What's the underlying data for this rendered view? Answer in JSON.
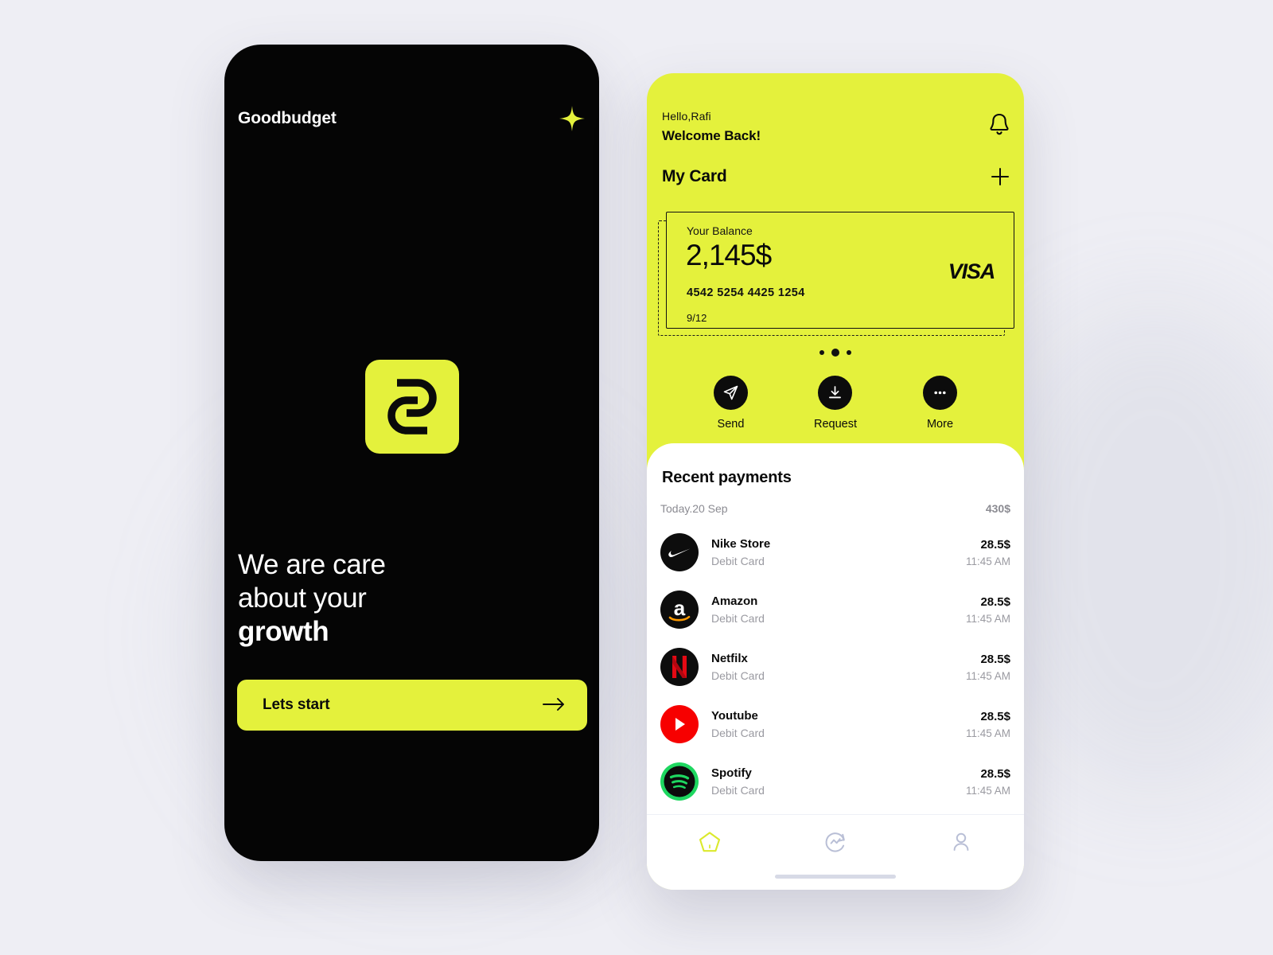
{
  "theme": {
    "accent": "#E4F13C",
    "black": "#050505",
    "page_background": "#EEEEF4",
    "sheet_background": "#FFFFFF",
    "muted_text": "#9A9AA1"
  },
  "onboarding": {
    "brand": "Goodbudget",
    "sparkle_icon": "sparkle-icon",
    "logo_icon": "goodbudget-logo-icon",
    "headline_lines": [
      "We are care",
      "about your",
      "growth"
    ],
    "cta_label": "Lets start",
    "cta_icon": "arrow-right-icon"
  },
  "dashboard": {
    "greeting_small": "Hello,Rafi",
    "greeting_large": "Welcome Back!",
    "bell_icon": "bell-icon",
    "section_title": "My Card",
    "add_icon": "plus-icon",
    "card": {
      "balance_label": "Your Balance",
      "balance_value": "2,145$",
      "number": "4542  5254  4425  1254",
      "expiry": "9/12",
      "network": "VISA"
    },
    "pagination": {
      "count": 3,
      "active_index": 1
    },
    "actions": [
      {
        "label": "Send",
        "icon": "send-plane-icon"
      },
      {
        "label": "Request",
        "icon": "download-tray-icon"
      },
      {
        "label": "More",
        "icon": "ellipsis-icon"
      }
    ],
    "payments": {
      "title": "Recent payments",
      "day_label": "Today.20 Sep",
      "day_total": "430$",
      "rows": [
        {
          "name": "Nike Store",
          "method": "Debit Card",
          "amount": "28.5$",
          "time": "11:45 AM",
          "icon": "nike-logo-icon"
        },
        {
          "name": "Amazon",
          "method": "Debit Card",
          "amount": "28.5$",
          "time": "11:45 AM",
          "icon": "amazon-logo-icon"
        },
        {
          "name": "Netfilx",
          "method": "Debit Card",
          "amount": "28.5$",
          "time": "11:45 AM",
          "icon": "netflix-logo-icon"
        },
        {
          "name": "Youtube",
          "method": "Debit Card",
          "amount": "28.5$",
          "time": "11:45 AM",
          "icon": "youtube-logo-icon"
        },
        {
          "name": "Spotify",
          "method": "Debit Card",
          "amount": "28.5$",
          "time": "11:45 AM",
          "icon": "spotify-logo-icon"
        }
      ]
    },
    "nav": [
      {
        "id": "home",
        "icon": "home-pentagon-icon",
        "active": true
      },
      {
        "id": "activity",
        "icon": "activity-circle-icon",
        "active": false
      },
      {
        "id": "profile",
        "icon": "person-icon",
        "active": false
      }
    ]
  }
}
